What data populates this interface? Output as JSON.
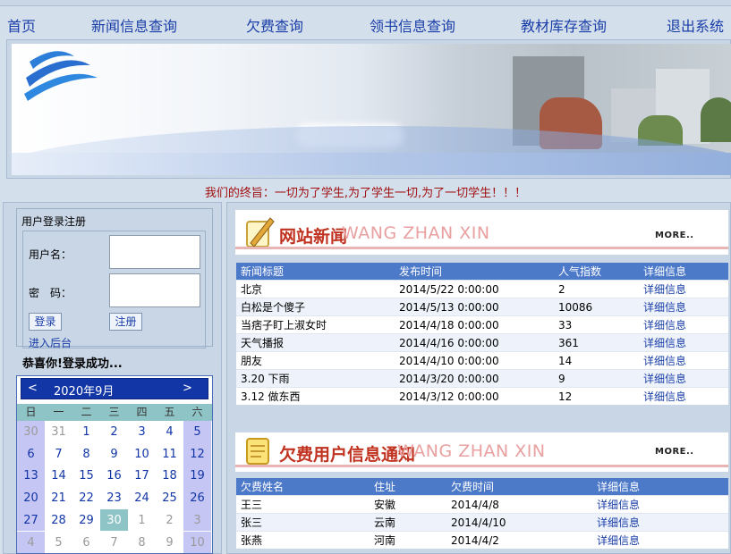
{
  "nav": {
    "items": [
      {
        "label": "首页"
      },
      {
        "label": "新闻信息查询"
      },
      {
        "label": "欠费查询"
      },
      {
        "label": "领书信息查询"
      },
      {
        "label": "教材库存查询"
      },
      {
        "label": "退出系统"
      }
    ]
  },
  "motto": "我们的终旨：一切为了学生,为了学生一切,为了一切学生！！！",
  "login": {
    "title": "用户登录注册",
    "username_label": "用户名：",
    "password_label": "密　码：",
    "login_button": "登录",
    "register_button": "注册",
    "admin_link": "进入后台",
    "success_message": "恭喜你!登录成功..."
  },
  "calendar": {
    "prev": "<",
    "next": ">",
    "month_label": "2020年9月",
    "weekdays": [
      "日",
      "一",
      "二",
      "三",
      "四",
      "五",
      "六"
    ],
    "weeks": [
      [
        "30",
        "31",
        "1",
        "2",
        "3",
        "4",
        "5"
      ],
      [
        "6",
        "7",
        "8",
        "9",
        "10",
        "11",
        "12"
      ],
      [
        "13",
        "14",
        "15",
        "16",
        "17",
        "18",
        "19"
      ],
      [
        "20",
        "21",
        "22",
        "23",
        "24",
        "25",
        "26"
      ],
      [
        "27",
        "28",
        "29",
        "30",
        "1",
        "2",
        "3"
      ],
      [
        "4",
        "5",
        "6",
        "7",
        "8",
        "9",
        "10"
      ]
    ],
    "selected_day": "30",
    "colors": {
      "header": "#1236a6",
      "weekend": "#c6c6f5",
      "weekday_row": "#8fc4c6",
      "selected": "#8fc4c6"
    }
  },
  "news": {
    "title": "网站新闻",
    "subtitle": "WANG ZHAN XIN",
    "more": "MORE..",
    "columns": [
      "新闻标题",
      "发布时间",
      "人气指数",
      "详细信息"
    ],
    "rows": [
      [
        "北京",
        "2014/5/22 0:00:00",
        "2",
        "详细信息"
      ],
      [
        "白松是个傻子",
        "2014/5/13 0:00:00",
        "10086",
        "详细信息"
      ],
      [
        "当痞子盯上淑女时",
        "2014/4/18 0:00:00",
        "33",
        "详细信息"
      ],
      [
        "天气播报",
        "2014/4/16 0:00:00",
        "361",
        "详细信息"
      ],
      [
        "朋友",
        "2014/4/10 0:00:00",
        "14",
        "详细信息"
      ],
      [
        "3.20 下雨",
        "2014/3/20 0:00:00",
        "9",
        "详细信息"
      ],
      [
        "3.12 做东西",
        "2014/3/12 0:00:00",
        "12",
        "详细信息"
      ]
    ]
  },
  "arrears": {
    "title": "欠费用户信息通知",
    "subtitle": "WANG ZHAN XIN",
    "more": "MORE..",
    "columns": [
      "欠费姓名",
      "住址",
      "欠费时间",
      "详细信息"
    ],
    "rows": [
      [
        "王三",
        "安徽",
        "2014/4/8",
        "详细信息"
      ],
      [
        "张三",
        "云南",
        "2014/4/10",
        "详细信息"
      ],
      [
        "张燕",
        "河南",
        "2014/4/2",
        "详细信息"
      ]
    ]
  }
}
